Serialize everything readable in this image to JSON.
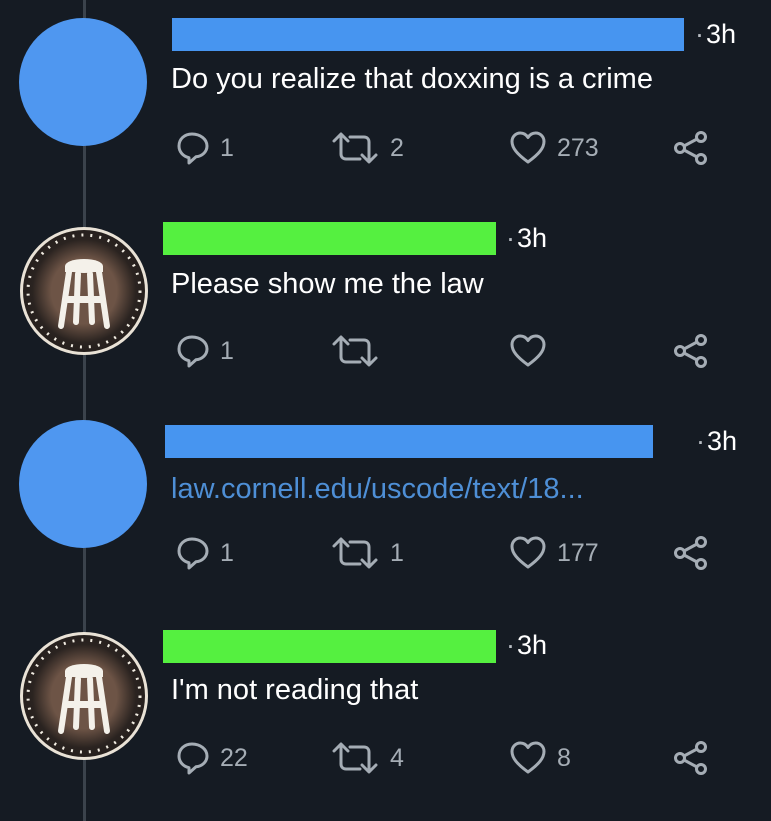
{
  "tweets": [
    {
      "time": "3h",
      "text": "Do you realize that doxxing is a crime",
      "replies": "1",
      "retweets": "2",
      "likes": "273",
      "avatar": "blue-circle"
    },
    {
      "time": "3h",
      "text": "Please show me the law",
      "replies": "1",
      "retweets": "",
      "likes": "",
      "avatar": "stool-logo"
    },
    {
      "time": "3h",
      "text": "law.cornell.edu/uscode/text/18...",
      "replies": "1",
      "retweets": "1",
      "likes": "177",
      "avatar": "blue-circle"
    },
    {
      "time": "3h",
      "text": "I'm not reading that",
      "replies": "22",
      "retweets": "4",
      "likes": "8",
      "avatar": "stool-logo"
    }
  ],
  "icons": {
    "reply": "reply-bubble-icon",
    "retweet": "retweet-arrows-icon",
    "like": "heart-icon",
    "share": "share-nodes-icon"
  },
  "colors": {
    "background": "#151b23",
    "redaction_blue": "#4795f0",
    "redaction_green": "#55f040",
    "link": "#4e8fd6",
    "action_gray": "#a5adb5"
  }
}
